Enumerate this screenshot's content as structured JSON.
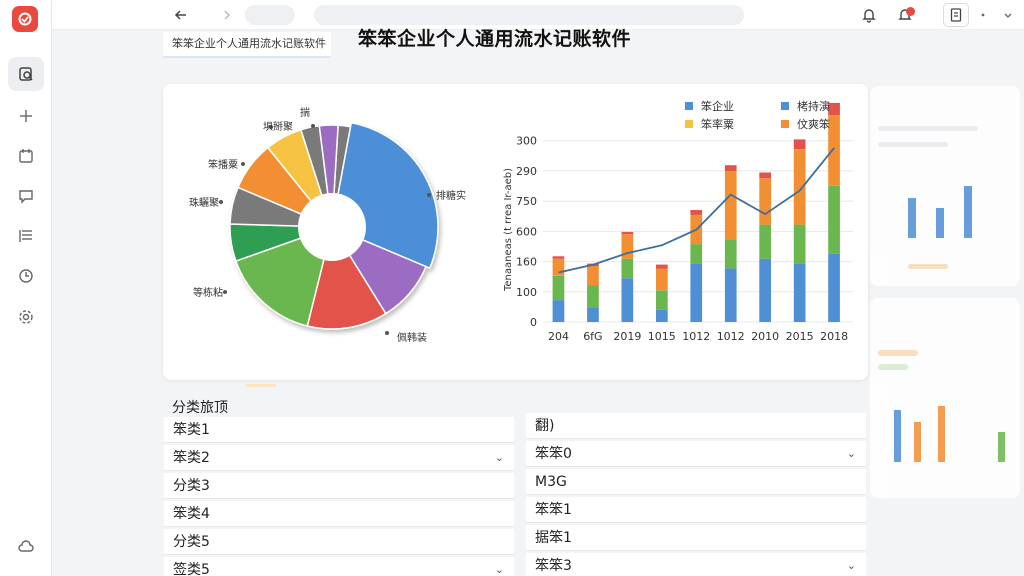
{
  "title": "笨笨企业个人通用流水记账软件",
  "tab_label": "笨笨企业个人通用流水记账软件",
  "icons": {
    "logo": "logo-icon",
    "sidebar": [
      "search-doc-icon",
      "plus-icon",
      "calendar-icon",
      "chat-icon",
      "list-icon",
      "clock-icon",
      "gear-icon"
    ],
    "topbar": [
      "back-arrow-icon",
      "forward-arrow-icon",
      "bell-icon",
      "notification-icon",
      "document-icon",
      "more-icon"
    ],
    "bottom": "cloud-icon"
  },
  "colors": {
    "accent": "#e84a3e",
    "blue": "#4e8fd6",
    "green": "#6ab74f",
    "orange": "#f28f32",
    "red": "#e2534a",
    "purple": "#9b6cc2",
    "yellow": "#f5c242",
    "gray": "#7a7a7a"
  },
  "chart_data": [
    {
      "type": "pie",
      "slices": [
        {
          "label": "揣",
          "value": 2,
          "color": "#7a7a7a"
        },
        {
          "label": "",
          "value": 29,
          "color": "#4e8fd6"
        },
        {
          "label": "",
          "value": 10,
          "color": "#9b6cc2"
        },
        {
          "label": "",
          "value": 13,
          "color": "#e2534a"
        },
        {
          "label": "",
          "value": 16,
          "color": "#6ab74f"
        },
        {
          "label": "",
          "value": 6,
          "color": "#2f9e52"
        },
        {
          "label": "",
          "value": 6,
          "color": "#7a7a7a"
        },
        {
          "label": "",
          "value": 8,
          "color": "#f28f32"
        },
        {
          "label": "",
          "value": 6,
          "color": "#f5c242"
        },
        {
          "label": "",
          "value": 3,
          "color": "#7a7a7a"
        },
        {
          "label": "",
          "value": 3,
          "color": "#9b6cc2"
        }
      ],
      "callouts": [
        "揣",
        "埧掰聚",
        "笨播粟",
        "珠矖聚",
        "等栋粘",
        "排糖实",
        "佩韩装"
      ]
    },
    {
      "type": "bar",
      "stacked": true,
      "categories": [
        "204",
        "6fG",
        "2019",
        "1015",
        "1012",
        "1012",
        "2010",
        "2015",
        "2018"
      ],
      "ylabel": "Tenaaneas (t rrea Ir-aeb)",
      "yticks": [
        "0",
        "100",
        "160",
        "600",
        "750",
        "290",
        "300"
      ],
      "legend": [
        "笨企业",
        "栲持演",
        "笨率粟",
        "伩爽笨"
      ],
      "legend_colors": [
        "#4e8fd6",
        "#4e8fd6",
        "#f5c242",
        "#f28f32"
      ],
      "series": [
        {
          "values": [
            45,
            30,
            90,
            25,
            120,
            110,
            130,
            120,
            140
          ],
          "color": "#4e8fd6"
        },
        {
          "values": [
            50,
            45,
            40,
            40,
            40,
            60,
            70,
            80,
            140
          ],
          "color": "#6ab74f"
        },
        {
          "values": [
            35,
            40,
            50,
            45,
            60,
            140,
            95,
            155,
            145
          ],
          "color": "#f28f32"
        },
        {
          "values": [
            5,
            5,
            5,
            8,
            10,
            12,
            12,
            20,
            25
          ],
          "color": "#e2534a"
        }
      ],
      "line": [
        25,
        35,
        50,
        60,
        80,
        125,
        100,
        130,
        185
      ]
    }
  ],
  "list_left": {
    "header": "分类旅顶",
    "rows": [
      {
        "label": "笨类1",
        "dropdown": false
      },
      {
        "label": "笨类2",
        "dropdown": true
      },
      {
        "label": "分类3",
        "dropdown": false
      },
      {
        "label": "笨类4",
        "dropdown": false
      },
      {
        "label": "分类5",
        "dropdown": false
      },
      {
        "label": "签类5",
        "dropdown": true
      }
    ]
  },
  "list_right": {
    "rows": [
      {
        "label": "翻)",
        "dropdown": false
      },
      {
        "label": "笨笨0",
        "dropdown": true
      },
      {
        "label": "M3G",
        "dropdown": false
      },
      {
        "label": "笨笨1",
        "dropdown": false
      },
      {
        "label": "据笨1",
        "dropdown": false
      },
      {
        "label": "笨笨3",
        "dropdown": true
      }
    ]
  }
}
